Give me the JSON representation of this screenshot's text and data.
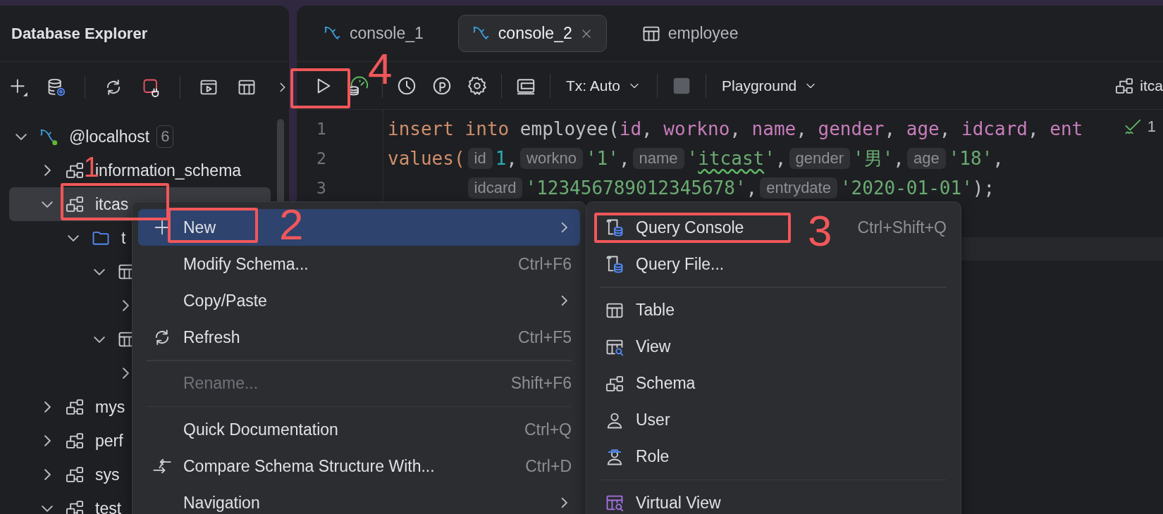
{
  "explorer": {
    "title": "Database Explorer",
    "tree": [
      {
        "label": "@localhost",
        "kind": "connection",
        "badge": "6",
        "expanded": true,
        "selected": false,
        "children": [
          {
            "label": "information_schema",
            "kind": "schema",
            "expanded": false,
            "selected": false
          },
          {
            "label": "itcas",
            "kind": "schema",
            "expanded": true,
            "selected": true,
            "children": [
              {
                "label": "t",
                "kind": "folder",
                "expanded": true,
                "selected": false,
                "children": [
                  {
                    "kind": "table",
                    "expanded": true,
                    "selected": false,
                    "children": [
                      {
                        "expanded": false,
                        "selected": false
                      }
                    ]
                  },
                  {
                    "kind": "table",
                    "expanded": true,
                    "selected": false,
                    "children": [
                      {
                        "expanded": false,
                        "selected": false
                      }
                    ]
                  }
                ]
              }
            ]
          },
          {
            "label": "mys",
            "kind": "schema",
            "expanded": false,
            "selected": false
          },
          {
            "label": "perf",
            "kind": "schema",
            "expanded": false,
            "selected": false
          },
          {
            "label": "sys",
            "kind": "schema",
            "expanded": false,
            "selected": false
          },
          {
            "label": "test",
            "kind": "schema",
            "expanded": true,
            "selected": false
          }
        ]
      }
    ]
  },
  "tabs": [
    {
      "label": "console_1",
      "kind": "console",
      "selected": false
    },
    {
      "label": "console_2",
      "kind": "console",
      "selected": true
    },
    {
      "label": "employee",
      "kind": "table",
      "selected": false
    }
  ],
  "toolbar": {
    "transaction": "Tx: Auto",
    "mode": "Playground",
    "schema": "itca"
  },
  "editor": {
    "inspection_count": "1",
    "lines": [
      {
        "number": "1",
        "continuation": false,
        "tokens": [
          {
            "kind": "keyword",
            "text": "insert into"
          },
          {
            "kind": "plain",
            "text": " employee("
          },
          {
            "kind": "column",
            "text": "id"
          },
          {
            "kind": "plain",
            "text": ", "
          },
          {
            "kind": "column",
            "text": "workno"
          },
          {
            "kind": "plain",
            "text": ", "
          },
          {
            "kind": "column",
            "text": "name"
          },
          {
            "kind": "plain",
            "text": ", "
          },
          {
            "kind": "column",
            "text": "gender"
          },
          {
            "kind": "plain",
            "text": ", "
          },
          {
            "kind": "column",
            "text": "age"
          },
          {
            "kind": "plain",
            "text": ", "
          },
          {
            "kind": "column",
            "text": "idcard"
          },
          {
            "kind": "plain",
            "text": ", "
          },
          {
            "kind": "column",
            "text": "ent"
          }
        ]
      },
      {
        "number": "2",
        "continuation": false,
        "tokens": [
          {
            "kind": "keyword",
            "text": "values("
          },
          {
            "kind": "hint",
            "text": "id"
          },
          {
            "kind": "number",
            "text": "1"
          },
          {
            "kind": "plain",
            "text": ","
          },
          {
            "kind": "hint",
            "text": "workno"
          },
          {
            "kind": "string",
            "text": "'1'"
          },
          {
            "kind": "plain",
            "text": ","
          },
          {
            "kind": "hint",
            "text": "name"
          },
          {
            "kind": "string",
            "text": "'"
          },
          {
            "kind": "typo",
            "text": "itcast"
          },
          {
            "kind": "string",
            "text": "'"
          },
          {
            "kind": "plain",
            "text": ","
          },
          {
            "kind": "hint",
            "text": "gender"
          },
          {
            "kind": "string",
            "text": "'男'"
          },
          {
            "kind": "plain",
            "text": ","
          },
          {
            "kind": "hint",
            "text": "age"
          },
          {
            "kind": "string",
            "text": "'18'"
          },
          {
            "kind": "plain",
            "text": ","
          }
        ]
      },
      {
        "number": "3",
        "continuation": true,
        "tokens": [
          {
            "kind": "hint",
            "text": "idcard"
          },
          {
            "kind": "string",
            "text": "'123456789012345678'"
          },
          {
            "kind": "plain",
            "text": ","
          },
          {
            "kind": "hint",
            "text": "entrydate"
          },
          {
            "kind": "string",
            "text": "'2020-01-01'"
          },
          {
            "kind": "plain",
            "text": ");"
          }
        ]
      }
    ]
  },
  "context_menu": {
    "items": [
      {
        "kind": "new",
        "label": "New",
        "submenu": true,
        "selected": true,
        "disabled": false
      },
      {
        "kind": "plain",
        "label": "Modify Schema...",
        "shortcut": "Ctrl+F6",
        "submenu": false,
        "selected": false,
        "disabled": false
      },
      {
        "kind": "plain",
        "label": "Copy/Paste",
        "submenu": true,
        "selected": false,
        "disabled": false
      },
      {
        "kind": "refresh",
        "label": "Refresh",
        "shortcut": "Ctrl+F5",
        "submenu": false,
        "selected": false,
        "disabled": false
      },
      {
        "kind": "separator"
      },
      {
        "kind": "plain",
        "label": "Rename...",
        "shortcut": "Shift+F6",
        "submenu": false,
        "selected": false,
        "disabled": true
      },
      {
        "kind": "separator"
      },
      {
        "kind": "plain",
        "label": "Quick Documentation",
        "shortcut": "Ctrl+Q",
        "submenu": false,
        "selected": false,
        "disabled": false
      },
      {
        "kind": "compare",
        "label": "Compare Schema Structure With...",
        "shortcut": "Ctrl+D",
        "submenu": false,
        "selected": false,
        "disabled": false
      },
      {
        "kind": "plain",
        "label": "Navigation",
        "submenu": true,
        "selected": false,
        "disabled": false
      }
    ]
  },
  "submenu": {
    "items": [
      {
        "kind": "console",
        "label": "Query Console",
        "shortcut": "Ctrl+Shift+Q",
        "selected": false
      },
      {
        "kind": "file",
        "label": "Query File...",
        "selected": false
      },
      {
        "kind": "separator"
      },
      {
        "kind": "table",
        "label": "Table",
        "selected": false
      },
      {
        "kind": "view",
        "label": "View",
        "selected": false
      },
      {
        "kind": "schema",
        "label": "Schema",
        "selected": false
      },
      {
        "kind": "user",
        "label": "User",
        "selected": false
      },
      {
        "kind": "role",
        "label": "Role",
        "selected": false
      },
      {
        "kind": "separator"
      },
      {
        "kind": "virtual_view",
        "label": "Virtual View",
        "selected": false
      }
    ]
  },
  "annotations": [
    {
      "label": "1"
    },
    {
      "label": "2"
    },
    {
      "label": "3"
    },
    {
      "label": "4"
    }
  ]
}
